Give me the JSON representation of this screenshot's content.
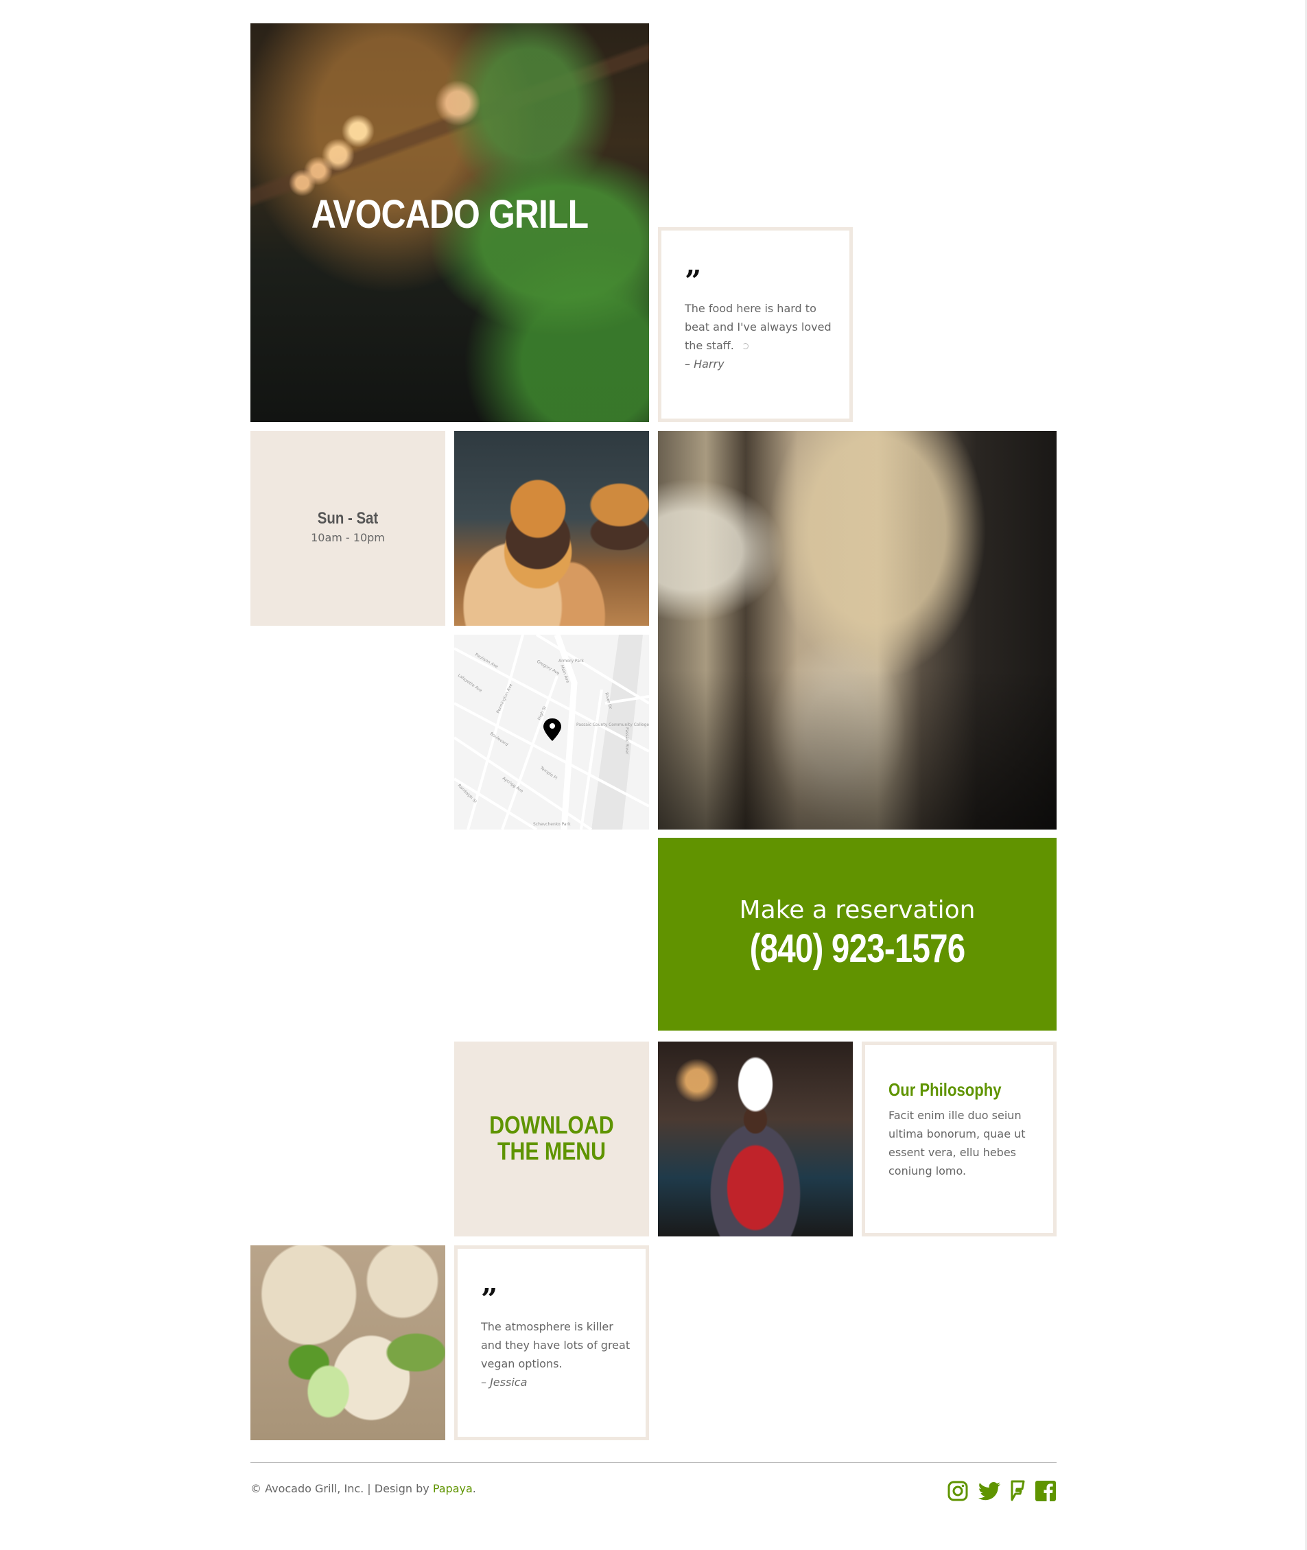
{
  "brand": {
    "title": "AVOCADO GRILL",
    "accent_color": "#619300",
    "beige_color": "#f0e8e0"
  },
  "testimonials": [
    {
      "quote_icon": "quote-icon",
      "text": "The food here is hard to beat and I've always loved the staff.",
      "author": "– Harry"
    },
    {
      "quote_icon": "quote-icon",
      "text": "The atmosphere is killer and they have lots of great vegan options.",
      "author": "– Jessica"
    }
  ],
  "hours": {
    "days": "Sun - Sat",
    "time": "10am - 10pm"
  },
  "map": {
    "labels": [
      "Paulison Ave",
      "Gregory Ave",
      "Armory Park",
      "Main Ave",
      "Lafayette Ave",
      "Pennington Ave",
      "High St",
      "Passaic County Community College",
      "River Dr",
      "Passaic River",
      "Boulevard",
      "Temple Pl",
      "Aycrigg Ave",
      "Randolph St",
      "Schevchenko Park"
    ],
    "marker_icon": "map-pin-icon"
  },
  "reservation": {
    "label": "Make a reservation",
    "phone": "(840) 923-1576"
  },
  "download_menu": {
    "line1": "DOWNLOAD",
    "line2": "THE MENU"
  },
  "philosophy": {
    "title": "Our Philosophy",
    "text": "Facit enim ille duo seiun ultima bonorum, quae ut essent vera, ellu hebes coniung lomo."
  },
  "images": {
    "hero": "restaurant-lights-image",
    "burger": "burger-image",
    "interior": "restaurant-interior-image",
    "chef": "chef-image",
    "tacos": "tacos-image"
  },
  "footer": {
    "copyright": "© Avocado Grill, Inc. | Design by ",
    "designer_link": "Papaya",
    "suffix": ".",
    "social": [
      "instagram-icon",
      "twitter-icon",
      "foursquare-icon",
      "facebook-icon"
    ]
  }
}
